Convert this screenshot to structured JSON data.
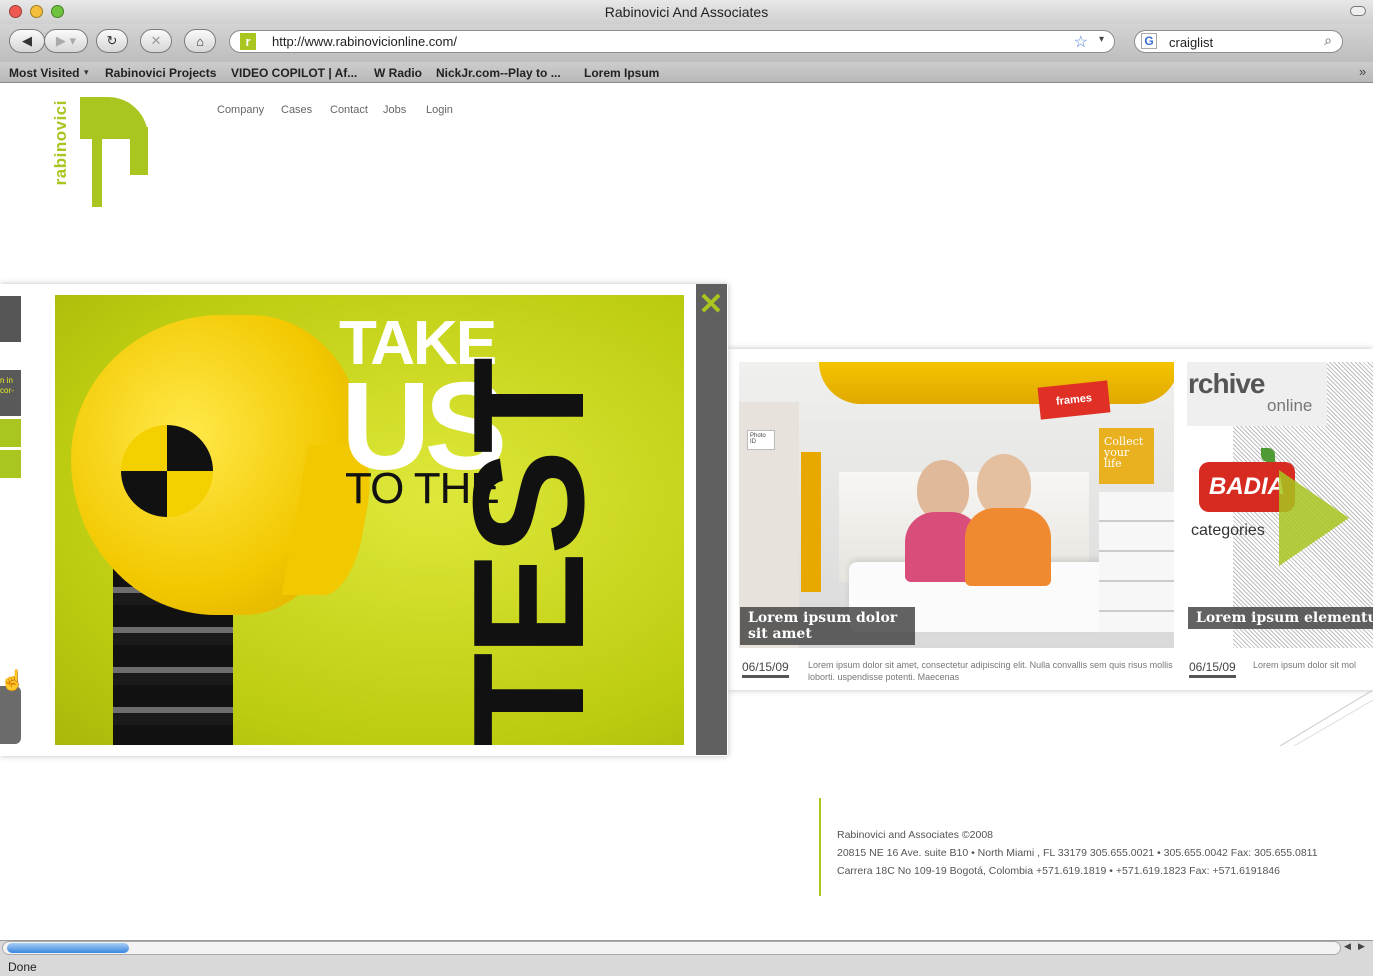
{
  "window": {
    "title": "Rabinovici And Associates"
  },
  "toolbar": {
    "url": "http://www.rabinovicionline.com/",
    "search_value": "craiglist"
  },
  "bookmarks": [
    "Most Visited",
    "Rabinovici Projects",
    "VIDEO COPILOT | Af...",
    "W Radio",
    "NickJr.com--Play to ...",
    "Lorem Ipsum"
  ],
  "logo": {
    "text": "rabinovici"
  },
  "nav": [
    "Company",
    "Cases",
    "Contact",
    "Jobs",
    "Login"
  ],
  "hero": {
    "line1": "TAKE",
    "line2": "US",
    "line3": "TO THE",
    "line4": "TEST"
  },
  "popup_left": {
    "snippet": "n in\ncor-"
  },
  "card1": {
    "caption": "Lorem ipsum dolor sit amet",
    "date": "06/15/09",
    "blurb": "Lorem ipsum dolor sit amet, consectetur adipiscing elit. Nulla convallis sem quis risus mollis loborti. uspendisse potenti. Maecenas",
    "signs": {
      "frames": "frames",
      "collect": "Collect your life",
      "photo": "Photo ID"
    }
  },
  "card2": {
    "brand": "rchive",
    "brand_sub": "online",
    "badia": "BADIA",
    "categories": "categories",
    "caption": "Lorem ipsum elementum honcus tortor",
    "date": "06/15/09",
    "blurb": "Lorem ipsum dolor sit mol"
  },
  "footer": {
    "line1": "Rabinovici and Associates ©2008",
    "line2": "20815 NE 16 Ave. suite B10 • North Miami , FL 33179     305.655.0021 • 305.655.0042   Fax: 305.655.0811",
    "line3": "Carrera 18C No 109-19 Bogotá, Colombia     +571.619.1819 • +571.619.1823  Fax: +571.6191846"
  },
  "status": {
    "text": "Done"
  },
  "colors": {
    "accent": "#a8c520",
    "hero_bg": "#c4d214",
    "panel_gray": "#5f5f5f"
  }
}
